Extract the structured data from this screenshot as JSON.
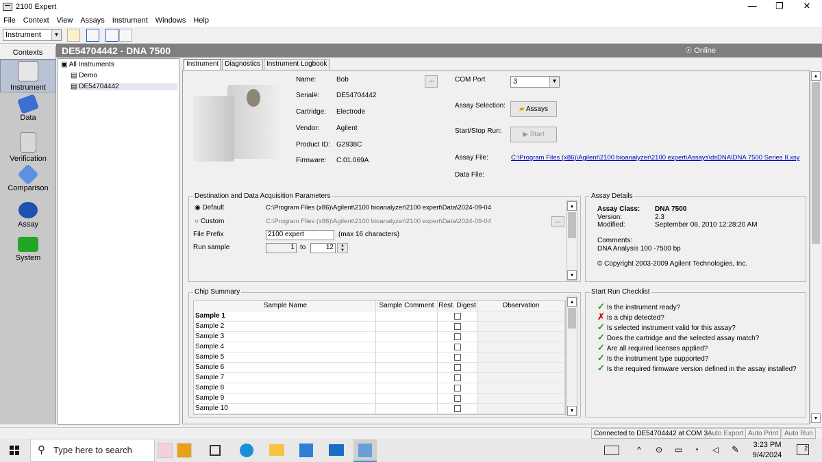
{
  "window": {
    "title": "2100 Expert",
    "controls": [
      "—",
      "❐",
      "✕"
    ]
  },
  "menu": [
    "File",
    "Context",
    "View",
    "Assays",
    "Instrument",
    "Windows",
    "Help"
  ],
  "toolbar": {
    "context_select": "Instrument"
  },
  "contexts": {
    "header": "Contexts",
    "items": [
      {
        "label": "Instrument",
        "icon": "instrument-icon",
        "selected": true
      },
      {
        "label": "Data",
        "icon": "data-icon"
      },
      {
        "label": "Verification",
        "icon": "verification-icon"
      },
      {
        "label": "Comparison",
        "icon": "comparison-icon"
      },
      {
        "label": "Assay",
        "icon": "assay-icon"
      },
      {
        "label": "System",
        "icon": "system-icon"
      }
    ]
  },
  "header": {
    "title": "DE54704442 - DNA 7500",
    "status": "Online"
  },
  "tree": {
    "root": "All Instruments",
    "children": [
      "Demo",
      "DE54704442"
    ]
  },
  "tabs": [
    "Instrument",
    "Diagnostics",
    "Instrument Logbook"
  ],
  "instrument": {
    "name_label": "Name:",
    "name": "Bob",
    "serial_label": "Serial#:",
    "serial": "DE54704442",
    "cartridge_label": "Cartridge:",
    "cartridge": "Electrode",
    "vendor_label": "Vendor:",
    "vendor": "Agilent",
    "product_label": "Product ID:",
    "product": "G2938C",
    "firmware_label": "Firmware:",
    "firmware": "C.01.069A",
    "browse_button": "...",
    "com_label": "COM Port",
    "com_value": "3",
    "assay_sel_label": "Assay Selection:",
    "assays_button": "Assays",
    "startstop_label": "Start/Stop Run:",
    "start_button": "Start",
    "assay_file_label": "Assay File:",
    "assay_file": "C:\\Program Files (x86)\\Agilent\\2100 bioanalyzer\\2100 expert\\Assays\\dsDNA\\DNA 7500 Series II.xsy",
    "data_file_label": "Data File:"
  },
  "destination": {
    "title": "Destination and Data Acquisition Parameters",
    "default_label": "Default",
    "default_path": "C:\\Program Files (x86)\\Agilent\\2100 bioanalyzer\\2100 expert\\Data\\2024-09-04",
    "custom_label": "Custom",
    "custom_path": "C:\\Program Files (x86)\\Agilent\\2100 bioanalyzer\\2100 expert\\Data\\2024-09-04",
    "browse_button": "...",
    "prefix_label": "File Prefix",
    "prefix_value": "2100 expert",
    "prefix_hint": "(max 16 characters)",
    "run_label": "Run sample",
    "run_from": "1",
    "to_label": "to",
    "run_to": "12"
  },
  "assay_details": {
    "title": "Assay Details",
    "class_label": "Assay Class:",
    "class_value": "DNA 7500",
    "version_label": "Version:",
    "version_value": "2.3",
    "modified_label": "Modified:",
    "modified_value": "September 08, 2010 12:28:20 AM",
    "comments_label": "Comments:",
    "comments_value": "DNA Analysis 100 -7500 bp",
    "copyright": "© Copyright 2003-2009 Agilent Technologies, Inc."
  },
  "chip_summary": {
    "title": "Chip Summary",
    "columns": [
      "Sample Name",
      "Sample Comment",
      "Rest. Digest",
      "Observation"
    ],
    "rows": [
      "Sample 1",
      "Sample 2",
      "Sample 3",
      "Sample 4",
      "Sample 5",
      "Sample 6",
      "Sample 7",
      "Sample 8",
      "Sample 9",
      "Sample 10"
    ]
  },
  "checklist": {
    "title": "Start Run Checklist",
    "items": [
      {
        "text": "Is the instrument ready?",
        "ok": true
      },
      {
        "text": "Is a chip detected?",
        "ok": false
      },
      {
        "text": "Is selected instrument valid for this assay?",
        "ok": true
      },
      {
        "text": "Does the cartridge and the selected assay match?",
        "ok": true
      },
      {
        "text": "Are all required licenses applied?",
        "ok": true
      },
      {
        "text": "Is the instrument type supported?",
        "ok": true
      },
      {
        "text": "Is the required firmware version defined in the assay installed?",
        "ok": true
      }
    ]
  },
  "statusbar": {
    "connected": "Connected to DE54704442 at COM 3",
    "auto_export": "Auto Export",
    "auto_print": "Auto Print",
    "auto_run": "Auto Run"
  },
  "taskbar": {
    "search_placeholder": "Type here to search",
    "time": "3:23 PM",
    "date": "9/4/2024",
    "notifications": "2"
  }
}
